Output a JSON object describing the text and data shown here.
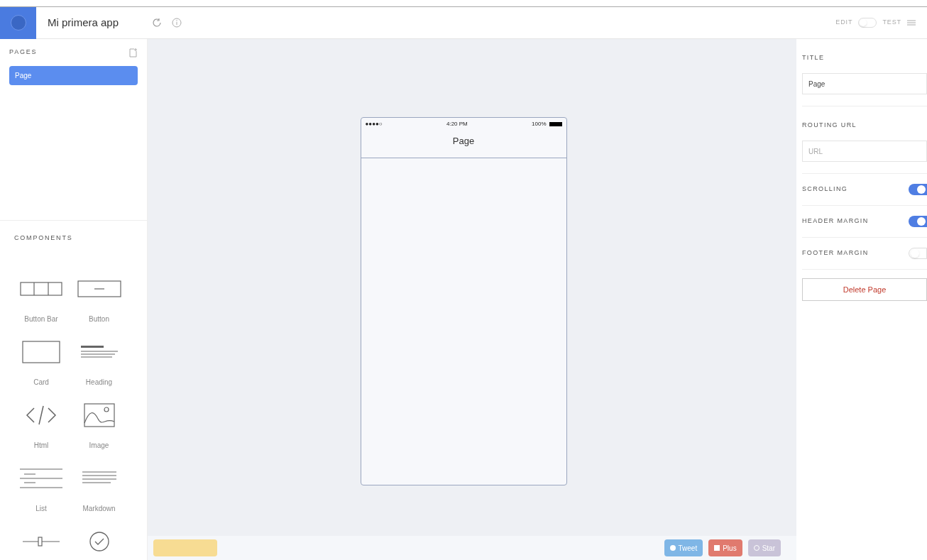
{
  "header": {
    "app_name": "Mi primera app",
    "mode_left": "EDIT",
    "mode_right": "TEST",
    "mode_on": false
  },
  "pages": {
    "title": "PAGES",
    "items": [
      {
        "label": "Page",
        "selected": true
      }
    ]
  },
  "components": {
    "title": "COMPONENTS",
    "items": [
      {
        "kind": "button-bar",
        "label": "Button Bar"
      },
      {
        "kind": "button",
        "label": "Button"
      },
      {
        "kind": "card",
        "label": "Card"
      },
      {
        "kind": "heading",
        "label": "Heading"
      },
      {
        "kind": "html",
        "label": "Html"
      },
      {
        "kind": "image",
        "label": "Image"
      },
      {
        "kind": "list",
        "label": "List"
      },
      {
        "kind": "markdown",
        "label": "Markdown"
      },
      {
        "kind": "range"
      },
      {
        "kind": "checkbox"
      }
    ]
  },
  "phone": {
    "carrier": "●●●●○",
    "time": "4:20 PM",
    "battery": "100%",
    "title": "Page"
  },
  "footer": {
    "buttons": [
      {
        "kind": "star",
        "label": "Tweet"
      },
      {
        "kind": "plus",
        "label": "Plus"
      },
      {
        "kind": "github",
        "label": "Star"
      }
    ]
  },
  "properties": {
    "title_label": "TITLE",
    "title_value": "Page",
    "url_label": "ROUTING URL",
    "url_placeholder": "URL",
    "toggles": [
      {
        "label": "SCROLLING",
        "on": true
      },
      {
        "label": "HEADER MARGIN",
        "on": true
      },
      {
        "label": "FOOTER MARGIN",
        "on": false
      }
    ],
    "delete": "Delete Page"
  }
}
